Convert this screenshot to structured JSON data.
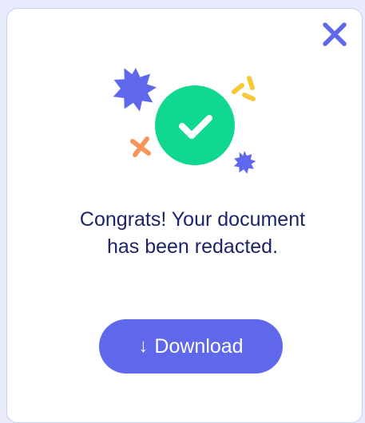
{
  "dialog": {
    "message_line1": "Congrats! Your document",
    "message_line2": "has been redacted.",
    "download_label": "Download",
    "download_icon": "↓",
    "close_icon": "close-icon",
    "illustration_icon": "checkmark-icon"
  },
  "colors": {
    "accent": "#5f67ea",
    "success": "#10d98f",
    "text": "#1d2469",
    "confetti_yellow": "#f5c93a",
    "confetti_orange": "#f7955a"
  }
}
